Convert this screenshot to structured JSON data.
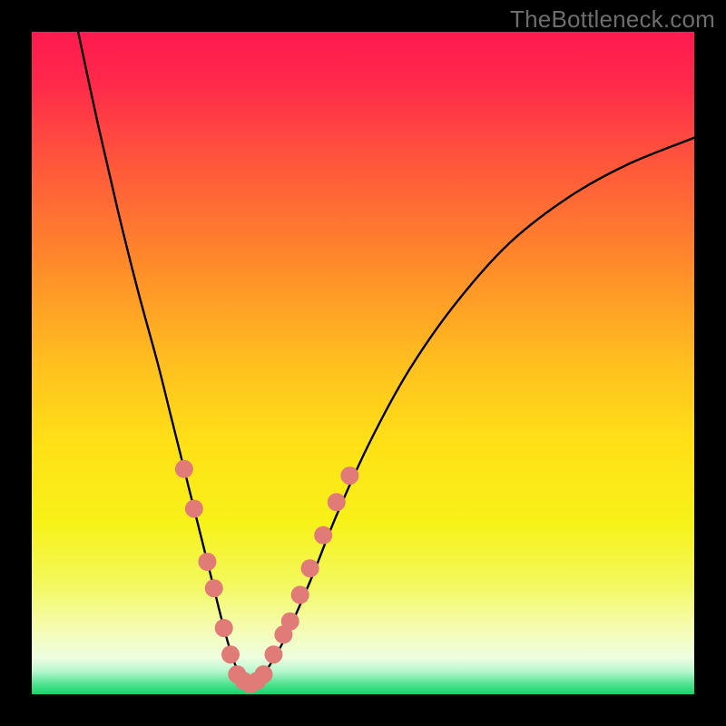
{
  "watermark": "TheBottleneck.com",
  "gradient": {
    "stops": [
      {
        "offset": 0.0,
        "color": "#ff1a4f"
      },
      {
        "offset": 0.08,
        "color": "#ff2a4a"
      },
      {
        "offset": 0.2,
        "color": "#ff573b"
      },
      {
        "offset": 0.35,
        "color": "#ff8a2a"
      },
      {
        "offset": 0.5,
        "color": "#ffbf1f"
      },
      {
        "offset": 0.62,
        "color": "#ffe017"
      },
      {
        "offset": 0.74,
        "color": "#f7f218"
      },
      {
        "offset": 0.83,
        "color": "#f3f85a"
      },
      {
        "offset": 0.9,
        "color": "#f5fcb0"
      },
      {
        "offset": 0.945,
        "color": "#eefee0"
      },
      {
        "offset": 0.965,
        "color": "#b8f7cf"
      },
      {
        "offset": 0.985,
        "color": "#4fe28e"
      },
      {
        "offset": 1.0,
        "color": "#17d36a"
      }
    ]
  },
  "chart_data": {
    "type": "line",
    "title": "",
    "xlabel": "",
    "ylabel": "",
    "xlim": [
      0,
      100
    ],
    "ylim": [
      0,
      100
    ],
    "series": [
      {
        "name": "bottleneck-curve",
        "x": [
          7,
          10,
          13,
          16,
          19,
          21,
          23,
          25,
          27,
          29,
          30.5,
          32,
          33.5,
          35,
          38,
          42,
          46,
          51,
          57,
          64,
          72,
          81,
          90,
          100
        ],
        "y": [
          100,
          86,
          73,
          61,
          50,
          42,
          34,
          26,
          18,
          10,
          5,
          2,
          1.5,
          3,
          8,
          17,
          27,
          38,
          49,
          59,
          68,
          75,
          80,
          84
        ]
      }
    ],
    "markers": {
      "name": "highlight-dots",
      "color": "#e07b78",
      "radius": 10,
      "points": [
        {
          "x": 23.0,
          "y": 34
        },
        {
          "x": 24.5,
          "y": 28
        },
        {
          "x": 26.5,
          "y": 20
        },
        {
          "x": 27.5,
          "y": 16
        },
        {
          "x": 29.0,
          "y": 10
        },
        {
          "x": 30.0,
          "y": 6
        },
        {
          "x": 31.0,
          "y": 3
        },
        {
          "x": 32.0,
          "y": 2
        },
        {
          "x": 33.0,
          "y": 1.5
        },
        {
          "x": 34.0,
          "y": 2
        },
        {
          "x": 35.0,
          "y": 3
        },
        {
          "x": 36.5,
          "y": 6
        },
        {
          "x": 38.0,
          "y": 9
        },
        {
          "x": 39.0,
          "y": 11
        },
        {
          "x": 40.5,
          "y": 15
        },
        {
          "x": 42.0,
          "y": 19
        },
        {
          "x": 44.0,
          "y": 24
        },
        {
          "x": 46.0,
          "y": 29
        },
        {
          "x": 48.0,
          "y": 33
        }
      ]
    }
  }
}
